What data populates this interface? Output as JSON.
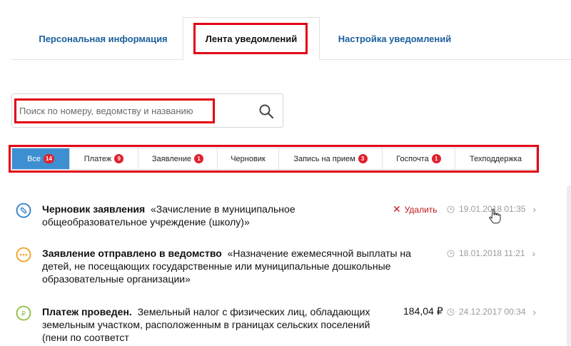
{
  "tabs": [
    {
      "label": "Персональная информация"
    },
    {
      "label": "Лента уведомлений"
    },
    {
      "label": "Настройка уведомлений"
    }
  ],
  "search": {
    "placeholder": "Поиск по номеру, ведомству и названию"
  },
  "filters": [
    {
      "label": "Все",
      "count": "14"
    },
    {
      "label": "Платеж",
      "count": "9"
    },
    {
      "label": "Заявление",
      "count": "1"
    },
    {
      "label": "Черновик",
      "count": ""
    },
    {
      "label": "Запись на прием",
      "count": "3"
    },
    {
      "label": "Госпочта",
      "count": "1"
    },
    {
      "label": "Техподдержка",
      "count": ""
    }
  ],
  "feed": [
    {
      "title": "Черновик заявления",
      "line1": "«Зачисление в муниципальное",
      "line2": "общеобразовательное учреждение (школу)»",
      "action": "Удалить",
      "datetime": "19.01.2018 01:35",
      "icon": "draft-icon"
    },
    {
      "title": "Заявление отправлено в ведомство",
      "line1": "«Назначение ежемесячной выплаты на",
      "line2": "детей, не посещающих государственные или муниципальные дошкольные",
      "line3": "образовательные организации»",
      "datetime": "18.01.2018 11:21",
      "icon": "pending-icon"
    },
    {
      "title": "Платеж проведен.",
      "line1": "Земельный налог с физических лиц, обладающих",
      "line2": "земельным участком, расположенным в границах сельских поселений",
      "line3": "(пени по соответст",
      "amount": "184,04 ₽",
      "datetime": "24.12.2017 00:34",
      "icon": "payment-icon"
    }
  ],
  "colors": {
    "accent": "#3d8fd1",
    "link": "#1b5f9c",
    "highlight": "#e10015",
    "badge": "#e1202b"
  }
}
